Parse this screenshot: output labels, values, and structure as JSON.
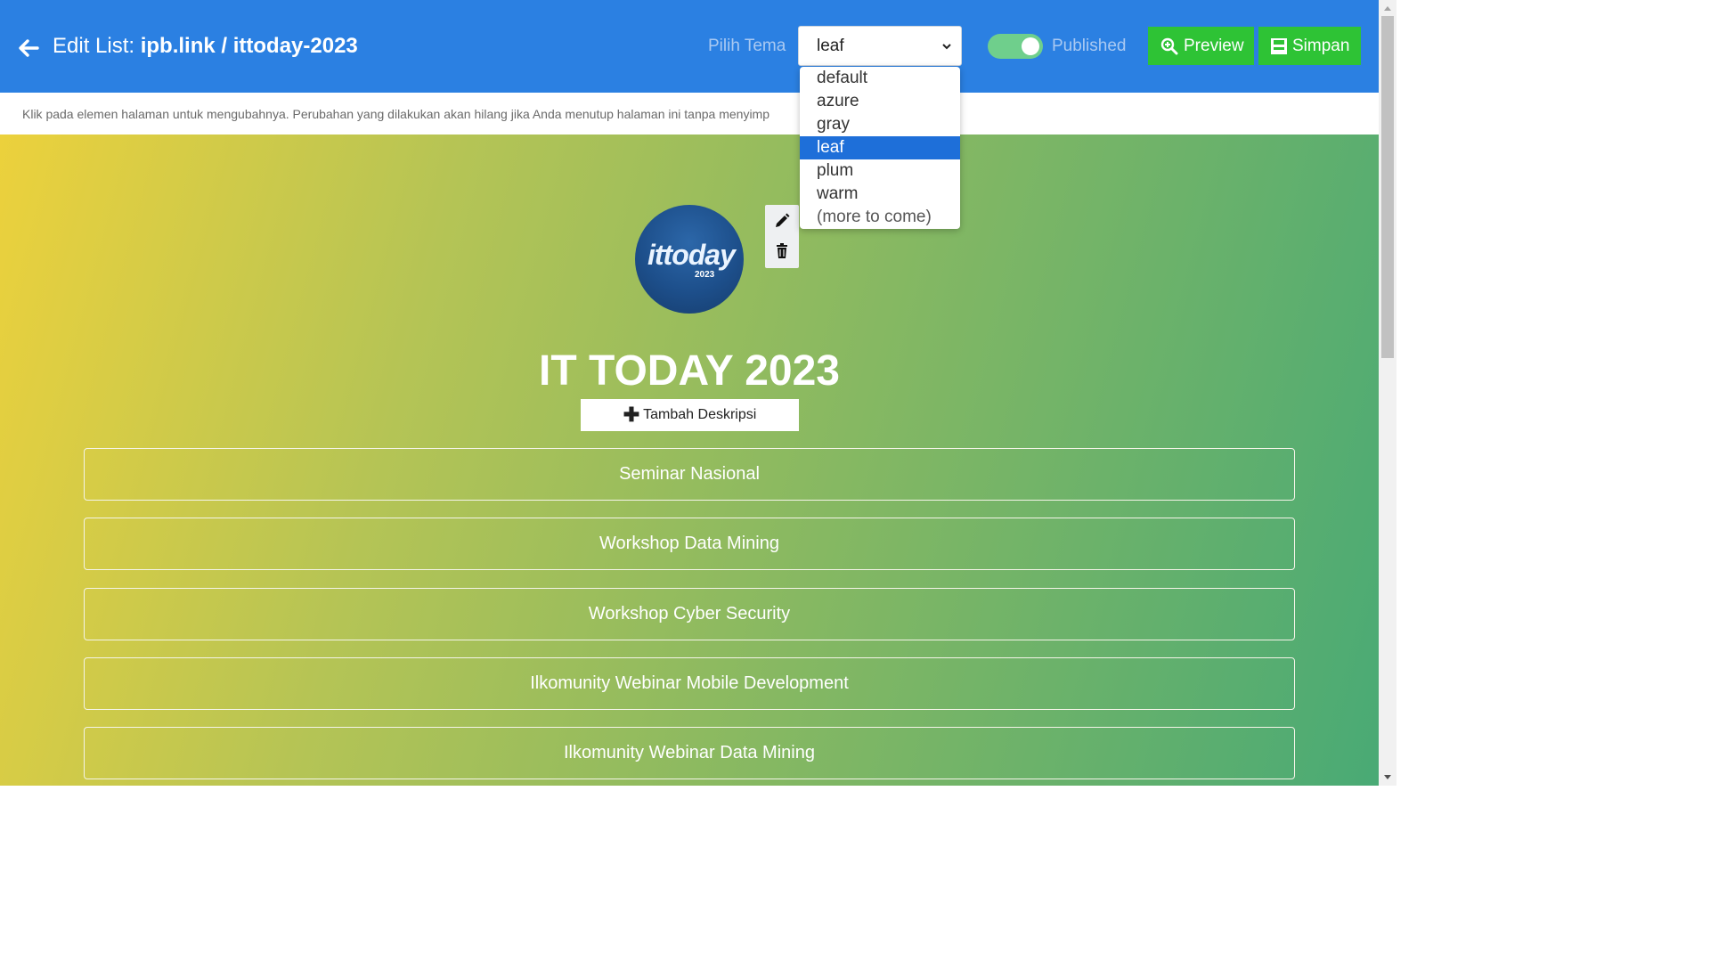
{
  "header": {
    "title_prefix": "Edit List: ",
    "title_path": "ipb.link / ittoday-2023",
    "theme_label": "Pilih Tema",
    "theme_value": "leaf",
    "published_label": "Published",
    "published_on": true,
    "preview_label": "Preview",
    "save_label": "Simpan"
  },
  "notice": "Klik pada elemen halaman untuk mengubahnya. Perubahan yang dilakukan akan hilang jika Anda menutup halaman ini tanpa menyimp",
  "profile": {
    "avatar_logo": "ittoday",
    "avatar_year": "2023",
    "title": "IT TODAY 2023",
    "add_description_label": "Tambah Deskripsi"
  },
  "links": [
    {
      "label": "Seminar Nasional"
    },
    {
      "label": "Workshop Data Mining"
    },
    {
      "label": "Workshop Cyber Security"
    },
    {
      "label": "Ilkomunity Webinar Mobile Development"
    },
    {
      "label": "Ilkomunity Webinar Data Mining"
    }
  ],
  "theme_options": [
    "default",
    "azure",
    "gray",
    "leaf",
    "plum",
    "warm",
    "(more to come)"
  ],
  "colors": {
    "header_bg": "#2b80e2",
    "button_green": "#2ec335",
    "toggle_on": "#6fcf8c",
    "selected_option": "#1e6fd9"
  }
}
